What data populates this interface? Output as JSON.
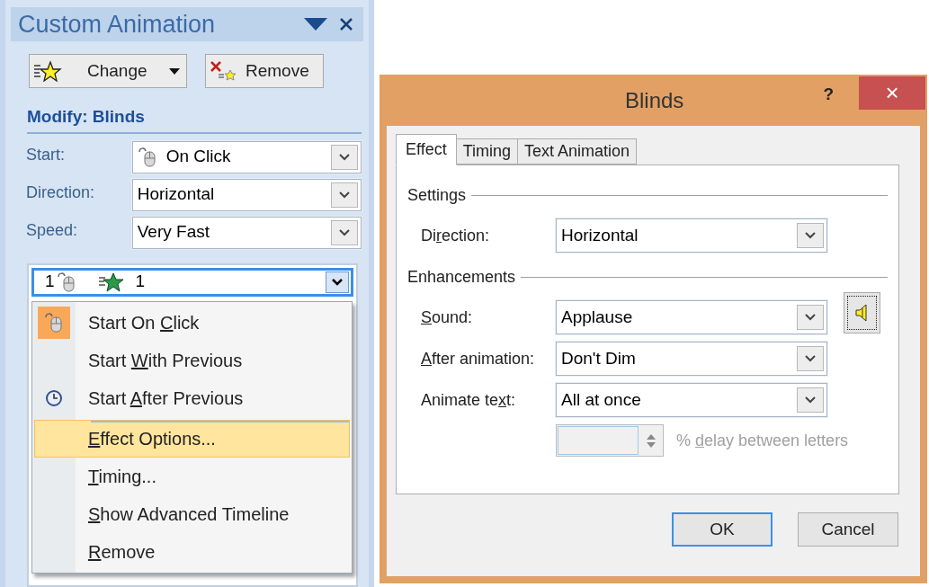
{
  "task_pane": {
    "title": "Custom Animation",
    "buttons": [
      {
        "label": "Change",
        "kind": "change"
      },
      {
        "label": "Remove",
        "kind": "remove"
      }
    ],
    "section": "Modify: Blinds",
    "fields": [
      {
        "label": "Start:",
        "value": "On Click",
        "kind": "mouse"
      },
      {
        "label": "Direction:",
        "value": "Horizontal",
        "kind": "plain"
      },
      {
        "label": "Speed:",
        "value": "Very Fast",
        "kind": "plain"
      }
    ],
    "list_item": {
      "order": "1",
      "name": "1"
    },
    "menu": [
      {
        "label": {
          "pre": "Start On ",
          "key": "C",
          "post": "lick"
        },
        "kind": "mouse",
        "checked": true,
        "selected": false,
        "separator_before": false
      },
      {
        "label": {
          "pre": "Start ",
          "key": "W",
          "post": "ith Previous"
        },
        "kind": "plain",
        "checked": false,
        "selected": false,
        "separator_before": false
      },
      {
        "label": {
          "pre": "Start ",
          "key": "A",
          "post": "fter Previous"
        },
        "kind": "clock",
        "checked": false,
        "selected": false,
        "separator_before": false
      },
      {
        "label": {
          "key": "E",
          "post": "ffect Options..."
        },
        "kind": "plain",
        "checked": false,
        "selected": true,
        "separator_before": true
      },
      {
        "label": {
          "key": "T",
          "post": "iming..."
        },
        "kind": "plain",
        "checked": false,
        "selected": false,
        "separator_before": false
      },
      {
        "label": {
          "key": "S",
          "post": "how Advanced Timeline"
        },
        "kind": "plain",
        "checked": false,
        "selected": false,
        "separator_before": false
      },
      {
        "label": {
          "key": "R",
          "post": "emove"
        },
        "kind": "plain",
        "checked": false,
        "selected": false,
        "separator_before": false
      }
    ]
  },
  "dialog": {
    "title": "Blinds",
    "help": "?",
    "close": "×",
    "tabs": [
      {
        "label": "Effect",
        "selected": true
      },
      {
        "label": "Timing",
        "selected": false
      },
      {
        "label": "Text Animation",
        "selected": false
      }
    ],
    "groups": [
      {
        "title": "Settings",
        "rows": [
          {
            "label": {
              "pre": "Di",
              "key": "r",
              "post": "ection:"
            },
            "value": "Horizontal",
            "sound_button": false
          }
        ]
      },
      {
        "title": "Enhancements",
        "rows": [
          {
            "label": {
              "key": "S",
              "post": "ound:"
            },
            "value": "Applause",
            "sound_button": true
          },
          {
            "label": {
              "key": "A",
              "post": "fter animation:"
            },
            "value": "Don't Dim",
            "sound_button": false
          },
          {
            "label": {
              "pre": "Animate te",
              "key": "x",
              "post": "t:"
            },
            "value": "All at once",
            "sound_button": false
          }
        ]
      }
    ],
    "delay": {
      "label": {
        "pre": "% ",
        "key": "d",
        "post": "elay between letters"
      },
      "disabled": true
    },
    "buttons": [
      {
        "label": "OK",
        "default": true
      },
      {
        "label": "Cancel",
        "default": false
      }
    ]
  }
}
